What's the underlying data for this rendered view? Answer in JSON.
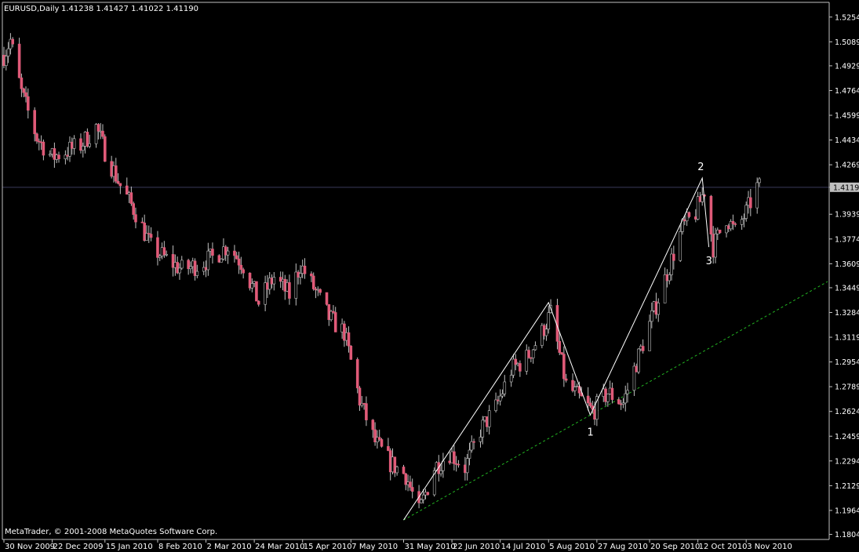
{
  "header": {
    "symbol": "EURUSD,Daily",
    "ohlc": "1.41238 1.41427 1.41022 1.41190"
  },
  "footer": {
    "copyright": "MetaTrader, © 2001-2008 MetaQuotes Software Corp."
  },
  "colors": {
    "background": "#000000",
    "axis": "#c0c0c0",
    "bull_candle": "#000000",
    "bear_candle": "#e05a78",
    "wick": "#c0c0c0",
    "wave_line": "#ffffff",
    "trend_line": "#22b422",
    "price_line": "#3a3a5a",
    "current_price_bg": "#c0c0c0",
    "current_price_text": "#000000"
  },
  "chart_data": {
    "type": "candlestick",
    "title": "EURUSD,Daily",
    "current_price": "1.41190",
    "ylim": [
      1.1786,
      1.5305
    ],
    "y_ticks": [
      "1.52540",
      "1.50890",
      "1.49290",
      "1.47640",
      "1.45990",
      "1.44340",
      "1.42690",
      "1.41190",
      "1.39390",
      "1.37740",
      "1.36090",
      "1.34490",
      "1.32840",
      "1.31190",
      "1.29540",
      "1.27890",
      "1.26240",
      "1.24590",
      "1.22940",
      "1.21290",
      "1.19640",
      "1.18040"
    ],
    "x_ticks": [
      "30 Nov 2009",
      "22 Dec 2009",
      "15 Jan 2010",
      "8 Feb 2010",
      "2 Mar 2010",
      "24 Mar 2010",
      "15 Apr 2010",
      "7 May 2010",
      "31 May 2010",
      "22 Jun 2010",
      "14 Jul 2010",
      "5 Aug 2010",
      "27 Aug 2010",
      "20 Sep 2010",
      "12 Oct 2010",
      "3 Nov 2010"
    ],
    "x_range": [
      "30 Nov 2009",
      "9 Nov 2010"
    ],
    "close_path": [
      [
        "30 Nov 2009",
        1.5
      ],
      [
        "3 Dec 2009",
        1.51
      ],
      [
        "8 Dec 2009",
        1.475
      ],
      [
        "15 Dec 2009",
        1.445
      ],
      [
        "22 Dec 2009",
        1.432
      ],
      [
        "4 Jan 2010",
        1.44
      ],
      [
        "11 Jan 2010",
        1.452
      ],
      [
        "15 Jan 2010",
        1.436
      ],
      [
        "22 Jan 2010",
        1.413
      ],
      [
        "29 Jan 2010",
        1.395
      ],
      [
        "5 Feb 2010",
        1.372
      ],
      [
        "12 Feb 2010",
        1.364
      ],
      [
        "19 Feb 2010",
        1.357
      ],
      [
        "26 Feb 2010",
        1.36
      ],
      [
        "5 Mar 2010",
        1.365
      ],
      [
        "12 Mar 2010",
        1.373
      ],
      [
        "19 Mar 2010",
        1.36
      ],
      [
        "26 Mar 2010",
        1.335
      ],
      [
        "2 Apr 2010",
        1.352
      ],
      [
        "9 Apr 2010",
        1.34
      ],
      [
        "14 Apr 2010",
        1.36
      ],
      [
        "20 Apr 2010",
        1.345
      ],
      [
        "27 Apr 2010",
        1.325
      ],
      [
        "4 May 2010",
        1.315
      ],
      [
        "11 May 2010",
        1.27
      ],
      [
        "18 May 2010",
        1.242
      ],
      [
        "25 May 2010",
        1.228
      ],
      [
        "1 Jun 2010",
        1.22
      ],
      [
        "7 Jun 2010",
        1.195
      ],
      [
        "14 Jun 2010",
        1.225
      ],
      [
        "21 Jun 2010",
        1.235
      ],
      [
        "28 Jun 2010",
        1.225
      ],
      [
        "5 Jul 2010",
        1.25
      ],
      [
        "12 Jul 2010",
        1.265
      ],
      [
        "19 Jul 2010",
        1.29
      ],
      [
        "26 Jul 2010",
        1.298
      ],
      [
        "2 Aug 2010",
        1.315
      ],
      [
        "6 Aug 2010",
        1.328
      ],
      [
        "13 Aug 2010",
        1.28
      ],
      [
        "20 Aug 2010",
        1.27
      ],
      [
        "25 Aug 2010",
        1.262
      ],
      [
        "1 Sep 2010",
        1.275
      ],
      [
        "8 Sep 2010",
        1.268
      ],
      [
        "14 Sep 2010",
        1.295
      ],
      [
        "21 Sep 2010",
        1.325
      ],
      [
        "28 Sep 2010",
        1.355
      ],
      [
        "5 Oct 2010",
        1.385
      ],
      [
        "11 Oct 2010",
        1.395
      ],
      [
        "15 Oct 2010",
        1.41
      ],
      [
        "19 Oct 2010",
        1.372
      ],
      [
        "25 Oct 2010",
        1.392
      ],
      [
        "29 Oct 2010",
        1.382
      ],
      [
        "3 Nov 2010",
        1.395
      ],
      [
        "8 Nov 2010",
        1.412
      ]
    ],
    "annotations": {
      "wave_points": [
        [
          "31 May 2010",
          1.19
        ],
        [
          "5 Aug 2010",
          1.335
        ],
        [
          "24 Aug 2010",
          1.26
        ],
        [
          "14 Oct 2010",
          1.418
        ],
        [
          "17 Oct 2010",
          1.372
        ]
      ],
      "wave_labels": [
        {
          "text": "1",
          "date": "24 Aug 2010",
          "price": 1.26
        },
        {
          "text": "2",
          "date": "14 Oct 2010",
          "price": 1.418
        },
        {
          "text": "3",
          "date": "17 Oct 2010",
          "price": 1.372
        }
      ],
      "trend_line": [
        [
          "31 May 2010",
          1.19
        ],
        [
          "24 Aug 2010",
          1.26
        ]
      ]
    }
  }
}
